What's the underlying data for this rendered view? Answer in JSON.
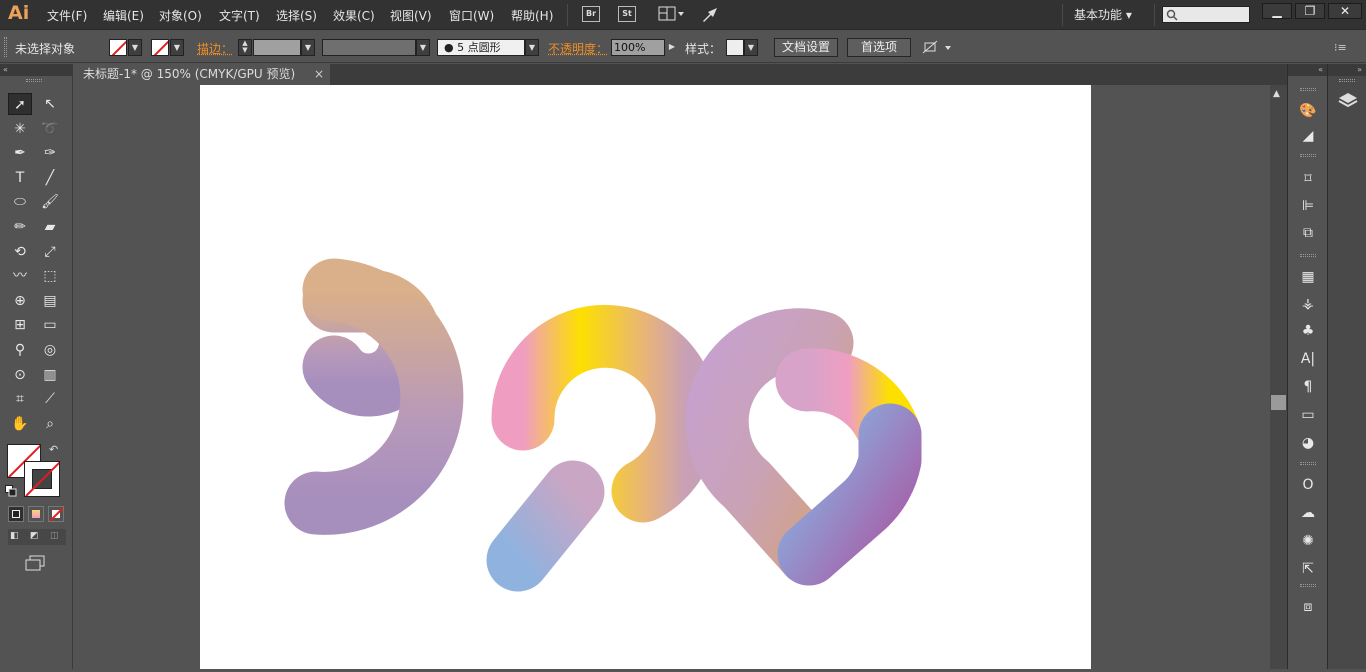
{
  "app": {
    "logo": "Ai"
  },
  "menus": [
    "文件(F)",
    "编辑(E)",
    "对象(O)",
    "文字(T)",
    "选择(S)",
    "效果(C)",
    "视图(V)",
    "窗口(W)",
    "帮助(H)"
  ],
  "bridge": {
    "br": "Br",
    "st": "St"
  },
  "workspace": {
    "label": "基本功能",
    "arrow": "▾"
  },
  "window": {
    "minimize": "▁",
    "restore": "❐",
    "close": "✕"
  },
  "control": {
    "selection": "未选择对象",
    "stroke_label": "描边：",
    "brush": "5 点圆形",
    "opacity_label": "不透明度：",
    "opacity_value": "100%",
    "style_label": "样式：",
    "doc_setup": "文档设置",
    "prefs": "首选项"
  },
  "document": {
    "tab_title": "未标题-1* @ 150% (CMYK/GPU 预览)",
    "close": "×"
  },
  "artwork": {
    "text": "520"
  },
  "colors": {
    "pink": "#e99fc3",
    "yellow": "#fde000",
    "blue": "#66b3e8",
    "purple": "#a65fa9",
    "lavender": "#b4a8cf",
    "orange": "#e8a25a"
  },
  "tools": [
    "selection-tool-icon",
    "direct-selection-tool-icon",
    "magic-wand-icon",
    "lasso-icon",
    "pen-icon",
    "curvature-icon",
    "type-icon",
    "line-icon",
    "ellipse-icon",
    "paintbrush-icon",
    "pencil-icon",
    "eraser-icon",
    "rotate-icon",
    "scale-icon",
    "warp-icon",
    "free-transform-icon",
    "shape-builder-icon",
    "perspective-icon",
    "mesh-icon",
    "gradient-icon",
    "eyedropper-icon",
    "blend-icon",
    "symbol-sprayer-icon",
    "graph-icon",
    "artboard-icon",
    "slice-icon",
    "hand-icon",
    "zoom-icon"
  ]
}
